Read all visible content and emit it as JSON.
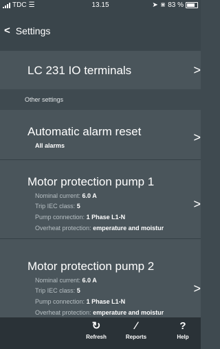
{
  "status": {
    "carrier": "TDC",
    "time": "13.15",
    "battery": "83 %"
  },
  "header": {
    "back_label": "Settings"
  },
  "lc_row": {
    "title": "LC 231 IO terminals"
  },
  "section": {
    "label": "Other settings"
  },
  "alarm": {
    "title": "Automatic alarm reset",
    "value": "All alarms"
  },
  "pump1": {
    "title": "Motor protection pump 1",
    "nominal_label": "Nominal current:",
    "nominal_value": "6.0 A",
    "trip_label": "Trip IEC class:",
    "trip_value": "5",
    "conn_label": "Pump connection:",
    "conn_value": "1 Phase L1-N",
    "overheat_label": "Overheat protection:",
    "overheat_value": "emperature and moistur"
  },
  "pump2": {
    "title": "Motor protection pump 2",
    "nominal_label": "Nominal current:",
    "nominal_value": "6.0 A",
    "trip_label": "Trip IEC class:",
    "trip_value": "5",
    "conn_label": "Pump connection:",
    "conn_value": "1 Phase L1-N",
    "overheat_label": "Overheat protection:",
    "overheat_value": "emperature and moistur"
  },
  "toolbar": {
    "refresh": {
      "icon": "refresh-icon",
      "label": "Refresh"
    },
    "reports": {
      "icon": "pencil-icon",
      "label": "Reports"
    },
    "help": {
      "icon": "question-icon",
      "label": "Help"
    }
  },
  "colors": {
    "background": "#3f4a50",
    "row": "#4a555b",
    "toolbar": "#2a3237",
    "text": "#ffffff"
  }
}
